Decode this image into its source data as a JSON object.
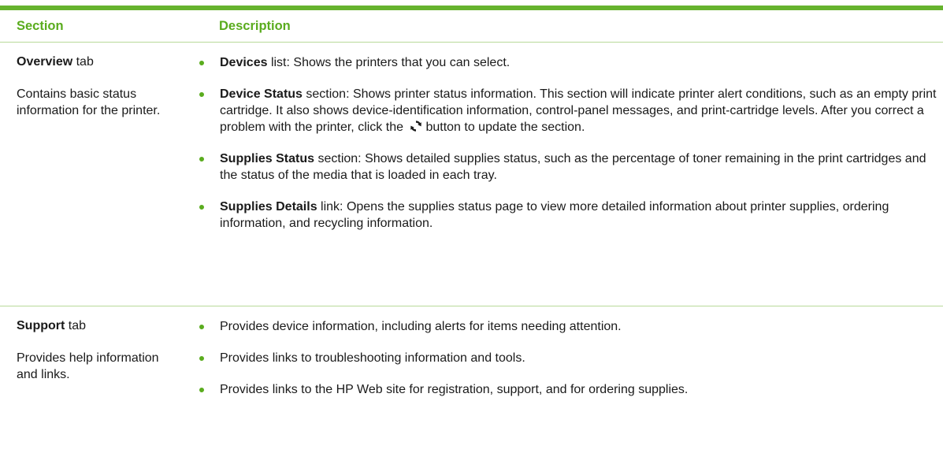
{
  "header": {
    "section_label": "Section",
    "description_label": "Description"
  },
  "rows": [
    {
      "section_bold": "Overview",
      "section_rest": " tab",
      "section_desc": "Contains basic status information for the printer.",
      "bullets": [
        {
          "bold": "Devices",
          "text": " list: Shows the printers that you can select."
        },
        {
          "bold": "Device Status",
          "text": " section: Shows printer status information. This section will indicate printer alert conditions, such as an empty print cartridge. It also shows device-identification information, control-panel messages, and print-cartridge levels. After you correct a problem with the printer, click the",
          "text_after": "button to update the section."
        },
        {
          "bold": "Supplies Status",
          "text": " section: Shows detailed supplies status, such as the percentage of toner remaining in the print cartridges and the status of the media that is loaded in each tray."
        },
        {
          "bold": "Supplies Details",
          "text": " link: Opens the supplies status page to view more detailed information about printer supplies, ordering information, and recycling information."
        }
      ]
    },
    {
      "section_bold": "Support",
      "section_rest": " tab",
      "section_desc": "Provides help information and links.",
      "bullets": [
        {
          "text": "Provides device information, including alerts for items needing attention."
        },
        {
          "text": "Provides links to troubleshooting information and tools."
        },
        {
          "text": "Provides links to the HP Web site for registration, support, and for ordering supplies."
        }
      ]
    }
  ],
  "colors": {
    "accent": "#66b32e",
    "header_text": "#5aac1e",
    "rule": "#b8d99a"
  },
  "icons": {
    "refresh": "refresh-icon"
  }
}
